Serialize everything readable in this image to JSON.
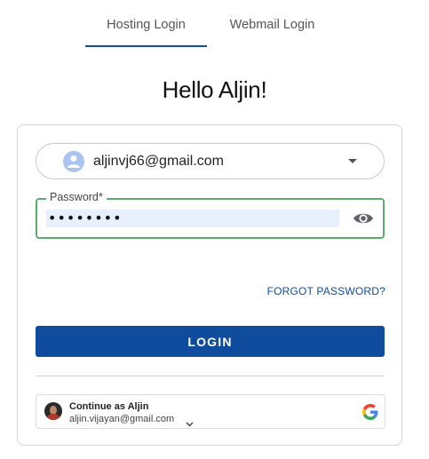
{
  "tabs": [
    {
      "label": "Hosting Login",
      "active": true
    },
    {
      "label": "Webmail Login",
      "active": false
    }
  ],
  "greeting": "Hello Aljin!",
  "account_selector": {
    "email": "aljinvj66@gmail.com",
    "avatar_icon": "user-icon",
    "dropdown_icon": "caret-down-icon"
  },
  "password": {
    "label": "Password*",
    "masked_value": "••••••••",
    "toggle_icon": "eye-icon"
  },
  "forgot_password_label": "FORGOT PASSWORD?",
  "login_button_label": "LOGIN",
  "google_continue": {
    "title": "Continue as Aljin",
    "email": "aljin.vijayan@gmail.com",
    "logo_icon": "google-g-icon"
  },
  "colors": {
    "accent": "#0f4c9e",
    "field_focus_border": "#5aae6a",
    "autofill_bg": "#e8f0fe",
    "avatar_bg": "#aac4f2"
  }
}
